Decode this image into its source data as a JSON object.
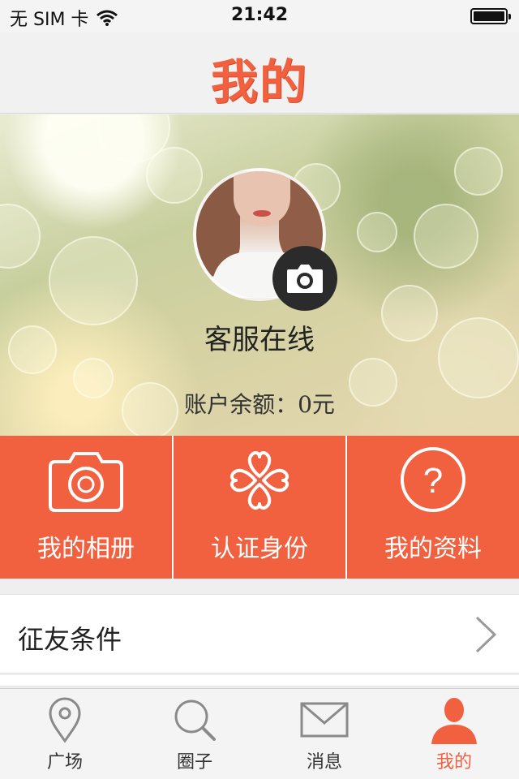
{
  "status_bar": {
    "carrier": "无 SIM 卡",
    "time": "21:42"
  },
  "nav": {
    "title": "我的"
  },
  "profile": {
    "name": "客服在线",
    "balance": "账户余额：0元"
  },
  "actions": [
    {
      "label": "我的相册",
      "icon": "camera-icon"
    },
    {
      "label": "认证身份",
      "icon": "clover-hearts-icon"
    },
    {
      "label": "我的资料",
      "icon": "question-circle-icon"
    }
  ],
  "list": {
    "item1": "征友条件"
  },
  "tabs": [
    {
      "label": "广场",
      "icon": "location-pin-icon"
    },
    {
      "label": "圈子",
      "icon": "search-icon"
    },
    {
      "label": "消息",
      "icon": "mail-icon"
    },
    {
      "label": "我的",
      "icon": "person-icon",
      "active": true
    }
  ],
  "colors": {
    "accent": "#f1603f",
    "tab_inactive": "#8a8a8a",
    "text": "#222222"
  }
}
